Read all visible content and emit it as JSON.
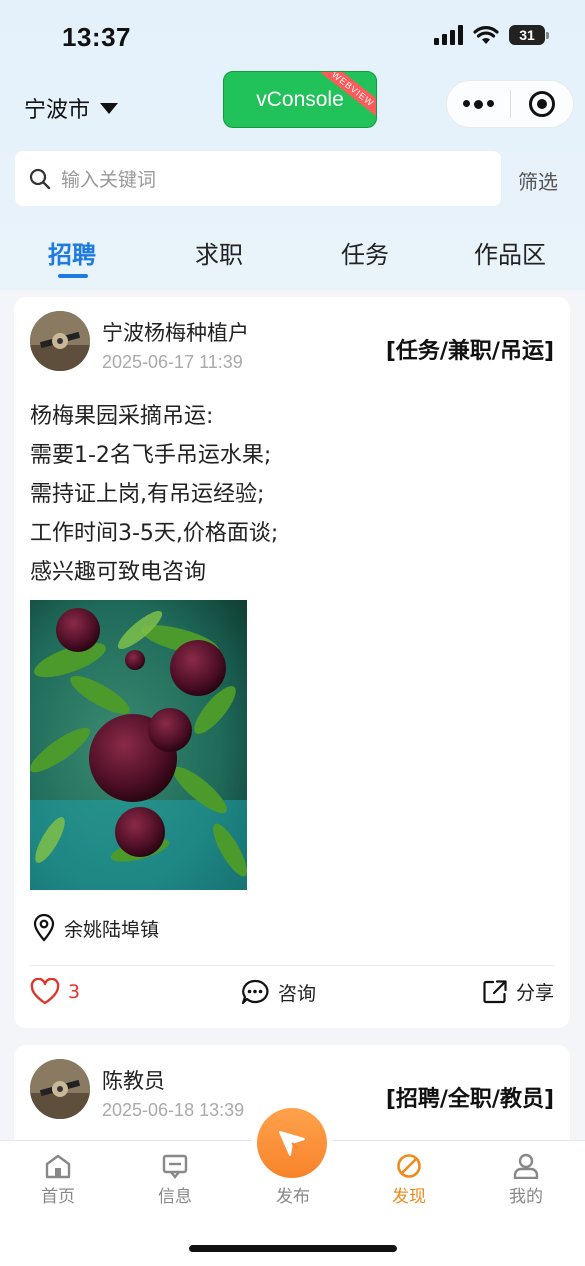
{
  "status_bar": {
    "time": "13:37",
    "battery": "31"
  },
  "header": {
    "city": "宁波市",
    "vconsole_label": "vConsole",
    "vconsole_ribbon": "WEBVIEW"
  },
  "search": {
    "placeholder": "输入关键词",
    "filter_label": "筛选"
  },
  "tabs": [
    {
      "label": "招聘",
      "active": true
    },
    {
      "label": "求职",
      "active": false
    },
    {
      "label": "任务",
      "active": false
    },
    {
      "label": "作品区",
      "active": false
    }
  ],
  "posts": [
    {
      "author": "宁波杨梅种植户",
      "time": "2025-06-17 11:39",
      "tag": "[任务/兼职/吊运]",
      "content": [
        "杨梅果园采摘吊运:",
        "需要1-2名飞手吊运水果;",
        "需持证上岗,有吊运经验;",
        "工作时间3-5天,价格面谈;",
        "感兴趣可致电咨询"
      ],
      "location": "余姚陆埠镇",
      "likes": "3",
      "consult_label": "咨询",
      "share_label": "分享"
    },
    {
      "author": "陈教员",
      "time": "2025-06-18 13:39",
      "tag": "[招聘/全职/教员]"
    }
  ],
  "bottom_nav": {
    "home": "首页",
    "messages": "信息",
    "publish": "发布",
    "discover": "发现",
    "mine": "我的",
    "active": "discover"
  },
  "colors": {
    "accent": "#1e7ae0",
    "orange": "#f08a1c",
    "like": "#e0352b",
    "vconsole": "#22c25a"
  }
}
